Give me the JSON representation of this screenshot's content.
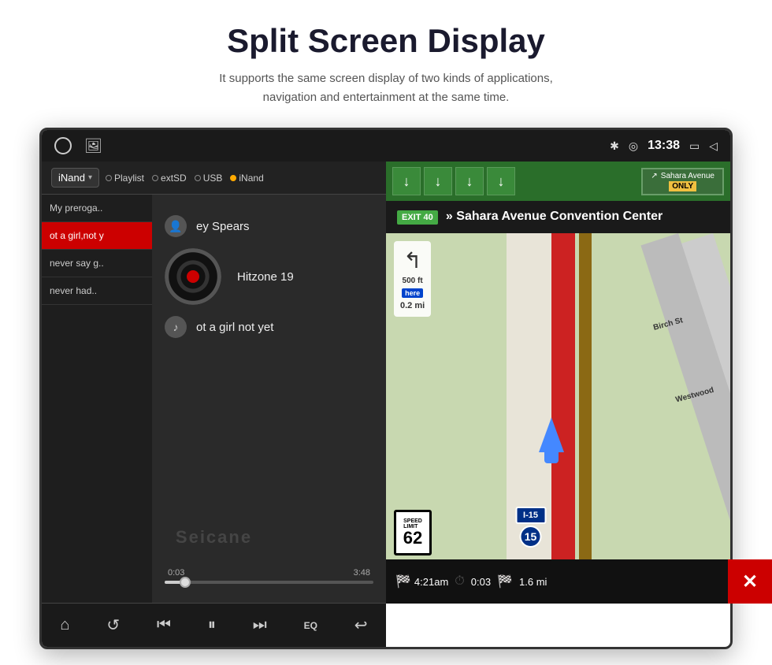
{
  "page": {
    "title": "Split Screen Display",
    "subtitle": "It supports the same screen display of two kinds of applications,\nnavigation and entertainment at the same time."
  },
  "status_bar": {
    "time": "13:38",
    "icons": [
      "bluetooth",
      "location",
      "screen",
      "back"
    ]
  },
  "music_player": {
    "source_label": "iNand",
    "sources": [
      "Playlist",
      "extSD",
      "USB",
      "iNand"
    ],
    "tracks": [
      {
        "title": "My preroga..",
        "active": false
      },
      {
        "title": "ot a girl,not y",
        "active": true
      },
      {
        "title": "never say g..",
        "active": false
      },
      {
        "title": "never had..",
        "active": false
      }
    ],
    "artist": "ey Spears",
    "album": "Hitzone 19",
    "song": "ot a girl not yet",
    "progress_current": "0:03",
    "progress_total": "3:48",
    "watermark": "Seicane"
  },
  "controls": {
    "home": "⌂",
    "repeat": "↺",
    "prev": "⏮",
    "play_pause": "⏸",
    "next": "⏭",
    "eq": "EQ",
    "back": "↩"
  },
  "navigation": {
    "highway_strip": {
      "arrows": [
        "↓",
        "↓",
        "↓",
        "↓"
      ],
      "only_text": "ONLY"
    },
    "exit_info": {
      "exit_badge": "EXIT 40",
      "description": "» Sahara Avenue Convention Center"
    },
    "turn": {
      "distance": "0.2 mi",
      "symbol": "↰"
    },
    "speed_limit": {
      "label": "SPEED LIMIT",
      "value": "62"
    },
    "highway": {
      "route": "I-15",
      "badge": "15"
    },
    "labels": {
      "birch": "Birch St",
      "westwood": "Westwood"
    },
    "eta": {
      "arrival": "4:21am",
      "elapsed": "0:03",
      "distance": "1.6 mi"
    }
  }
}
